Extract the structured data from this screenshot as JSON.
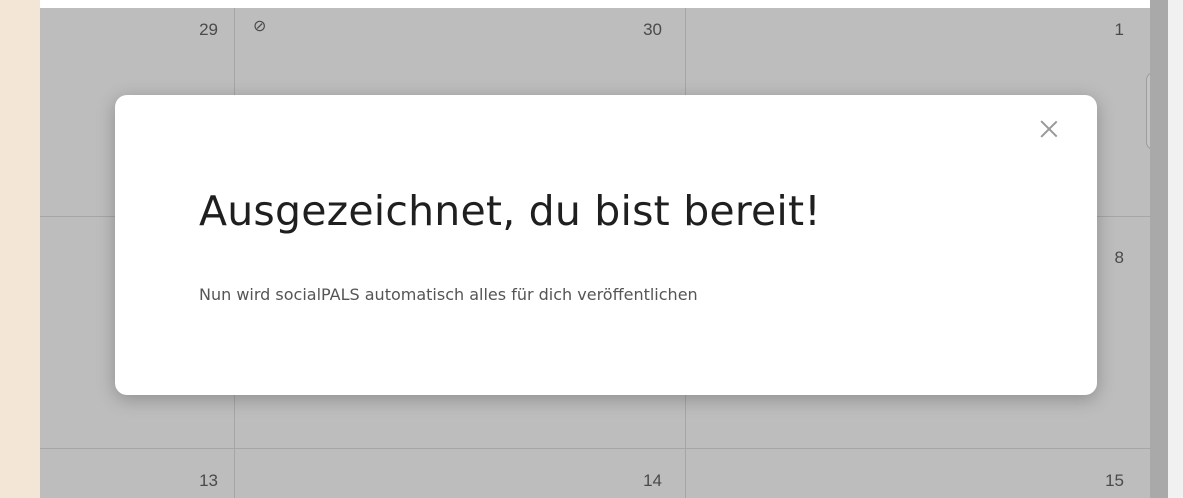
{
  "calendar": {
    "days": {
      "d29": "29",
      "d30": "30",
      "d1": "1",
      "d8": "8",
      "d13": "13",
      "d14": "14",
      "d15": "15"
    },
    "cancel_glyph": "⊘"
  },
  "modal": {
    "title": "Ausgezeichnet, du bist bereit!",
    "message": "Nun wird socialPALS automatisch alles für dich veröffentlichen",
    "close_icon": "close-icon"
  },
  "colors": {
    "overlay_gray": "#bdbdbd",
    "sidebar_beige": "#f4e6d6",
    "modal_bg": "#ffffff",
    "title_text": "#1f1f1f",
    "body_text": "#555555"
  }
}
